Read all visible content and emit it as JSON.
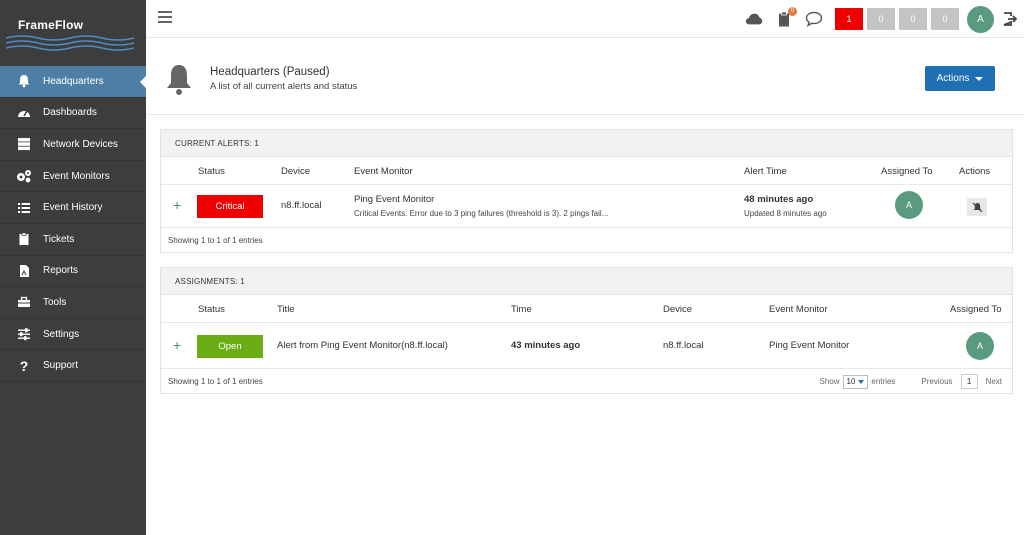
{
  "app": {
    "brand": "FrameFlow"
  },
  "sidebar": {
    "items": [
      {
        "label": "Headquarters",
        "icon": "bell-icon"
      },
      {
        "label": "Dashboards",
        "icon": "dashboard-gauge-icon"
      },
      {
        "label": "Network Devices",
        "icon": "server-icon"
      },
      {
        "label": "Event Monitors",
        "icon": "gears-icon"
      },
      {
        "label": "Event History",
        "icon": "list-icon"
      },
      {
        "label": "Tickets",
        "icon": "clipboard-icon"
      },
      {
        "label": "Reports",
        "icon": "report-file-icon"
      },
      {
        "label": "Tools",
        "icon": "toolbox-icon"
      },
      {
        "label": "Settings",
        "icon": "sliders-icon"
      },
      {
        "label": "Support",
        "icon": "question-icon"
      }
    ],
    "active": "Headquarters"
  },
  "topbar": {
    "tickets_badge": "0",
    "counts": [
      "1",
      "0",
      "0",
      "0"
    ],
    "avatar": "A"
  },
  "header": {
    "title": "Headquarters (Paused)",
    "subtitle": "A list of all current alerts and status",
    "actions_label": "Actions"
  },
  "alerts": {
    "title": "CURRENT ALERTS: 1",
    "columns": {
      "status": "Status",
      "device": "Device",
      "event_monitor": "Event Monitor",
      "alert_time": "Alert Time",
      "assigned_to": "Assigned To",
      "actions": "Actions"
    },
    "rows": [
      {
        "status": "Critical",
        "device": "n8.ff.local",
        "monitor": "Ping Event Monitor",
        "detail": "Critical Events: Error due to 3 ping failures (threshold is 3). 2 pings fail...",
        "time": "48 minutes ago",
        "updated": "Updated 8 minutes ago",
        "assigned": "A"
      }
    ],
    "footer": "Showing 1 to 1 of 1 entries"
  },
  "assignments": {
    "title": "ASSIGNMENTS: 1",
    "columns": {
      "status": "Status",
      "title": "Title",
      "time": "Time",
      "device": "Device",
      "event_monitor": "Event Monitor",
      "assigned_to": "Assigned To"
    },
    "rows": [
      {
        "status": "Open",
        "title": "Alert from Ping Event Monitor(n8.ff.local)",
        "time": "43 minutes ago",
        "device": "n8.ff.local",
        "monitor": "Ping Event Monitor",
        "assigned": "A"
      }
    ],
    "footer": "Showing 1 to 1 of 1 entries",
    "show_label": "Show",
    "page_size": "10",
    "entries_label": "entries",
    "prev": "Previous",
    "page": "1",
    "next": "Next"
  },
  "colors": {
    "sidebar": "#3d3d3d",
    "active": "#4d7fa6",
    "critical": "#ef0000",
    "open": "#6aad14",
    "primary": "#1f6fb3",
    "avatar": "#5a9a7e"
  }
}
